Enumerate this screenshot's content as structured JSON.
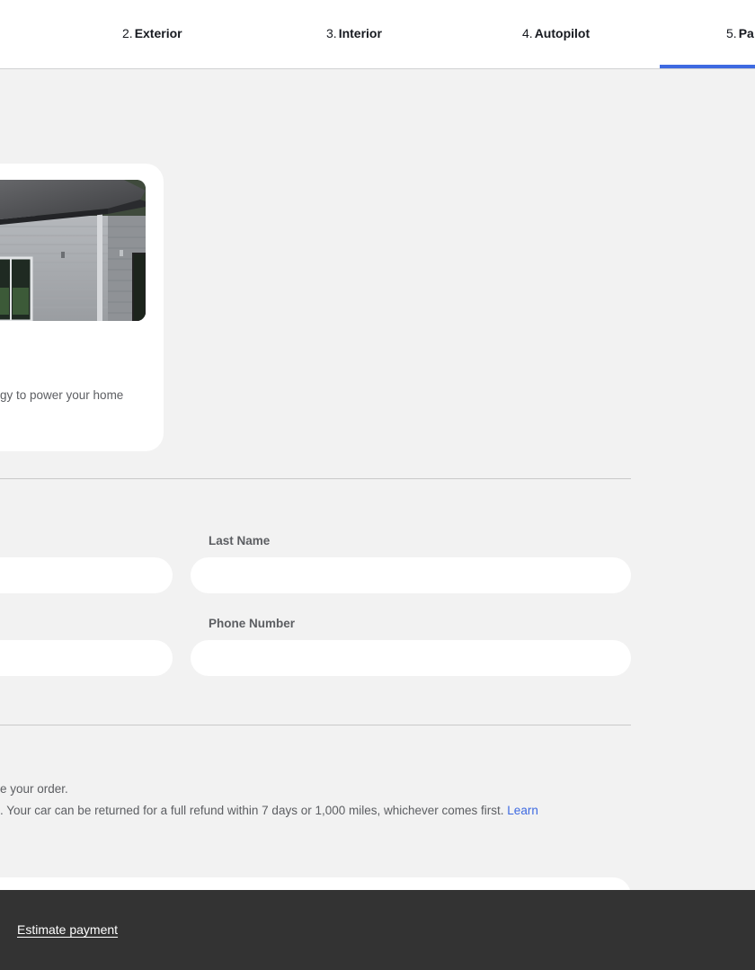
{
  "steps": [
    {
      "num": "2.",
      "label": "Exterior"
    },
    {
      "num": "3.",
      "label": "Interior"
    },
    {
      "num": "4.",
      "label": "Autopilot"
    },
    {
      "num": "5.",
      "label": "Pa"
    }
  ],
  "active_step_index": 3,
  "colors": {
    "accent": "#3e6ae1",
    "background": "#f2f2f2",
    "footer": "#333333"
  },
  "product_card": {
    "image": "house-with-solar-roof",
    "description": "gy to power your home"
  },
  "form": {
    "last_name_label": "Last Name",
    "last_name_value": "",
    "first_name_value": "",
    "phone_label": "Phone Number",
    "phone_value": "",
    "email_value": ""
  },
  "info": {
    "line1": "e your order.",
    "line2": ". Your car can be returned for a full refund within 7 days or 1,000 miles, whichever comes first.",
    "link": "Learn"
  },
  "footer": {
    "estimate_label": "Estimate payment"
  }
}
